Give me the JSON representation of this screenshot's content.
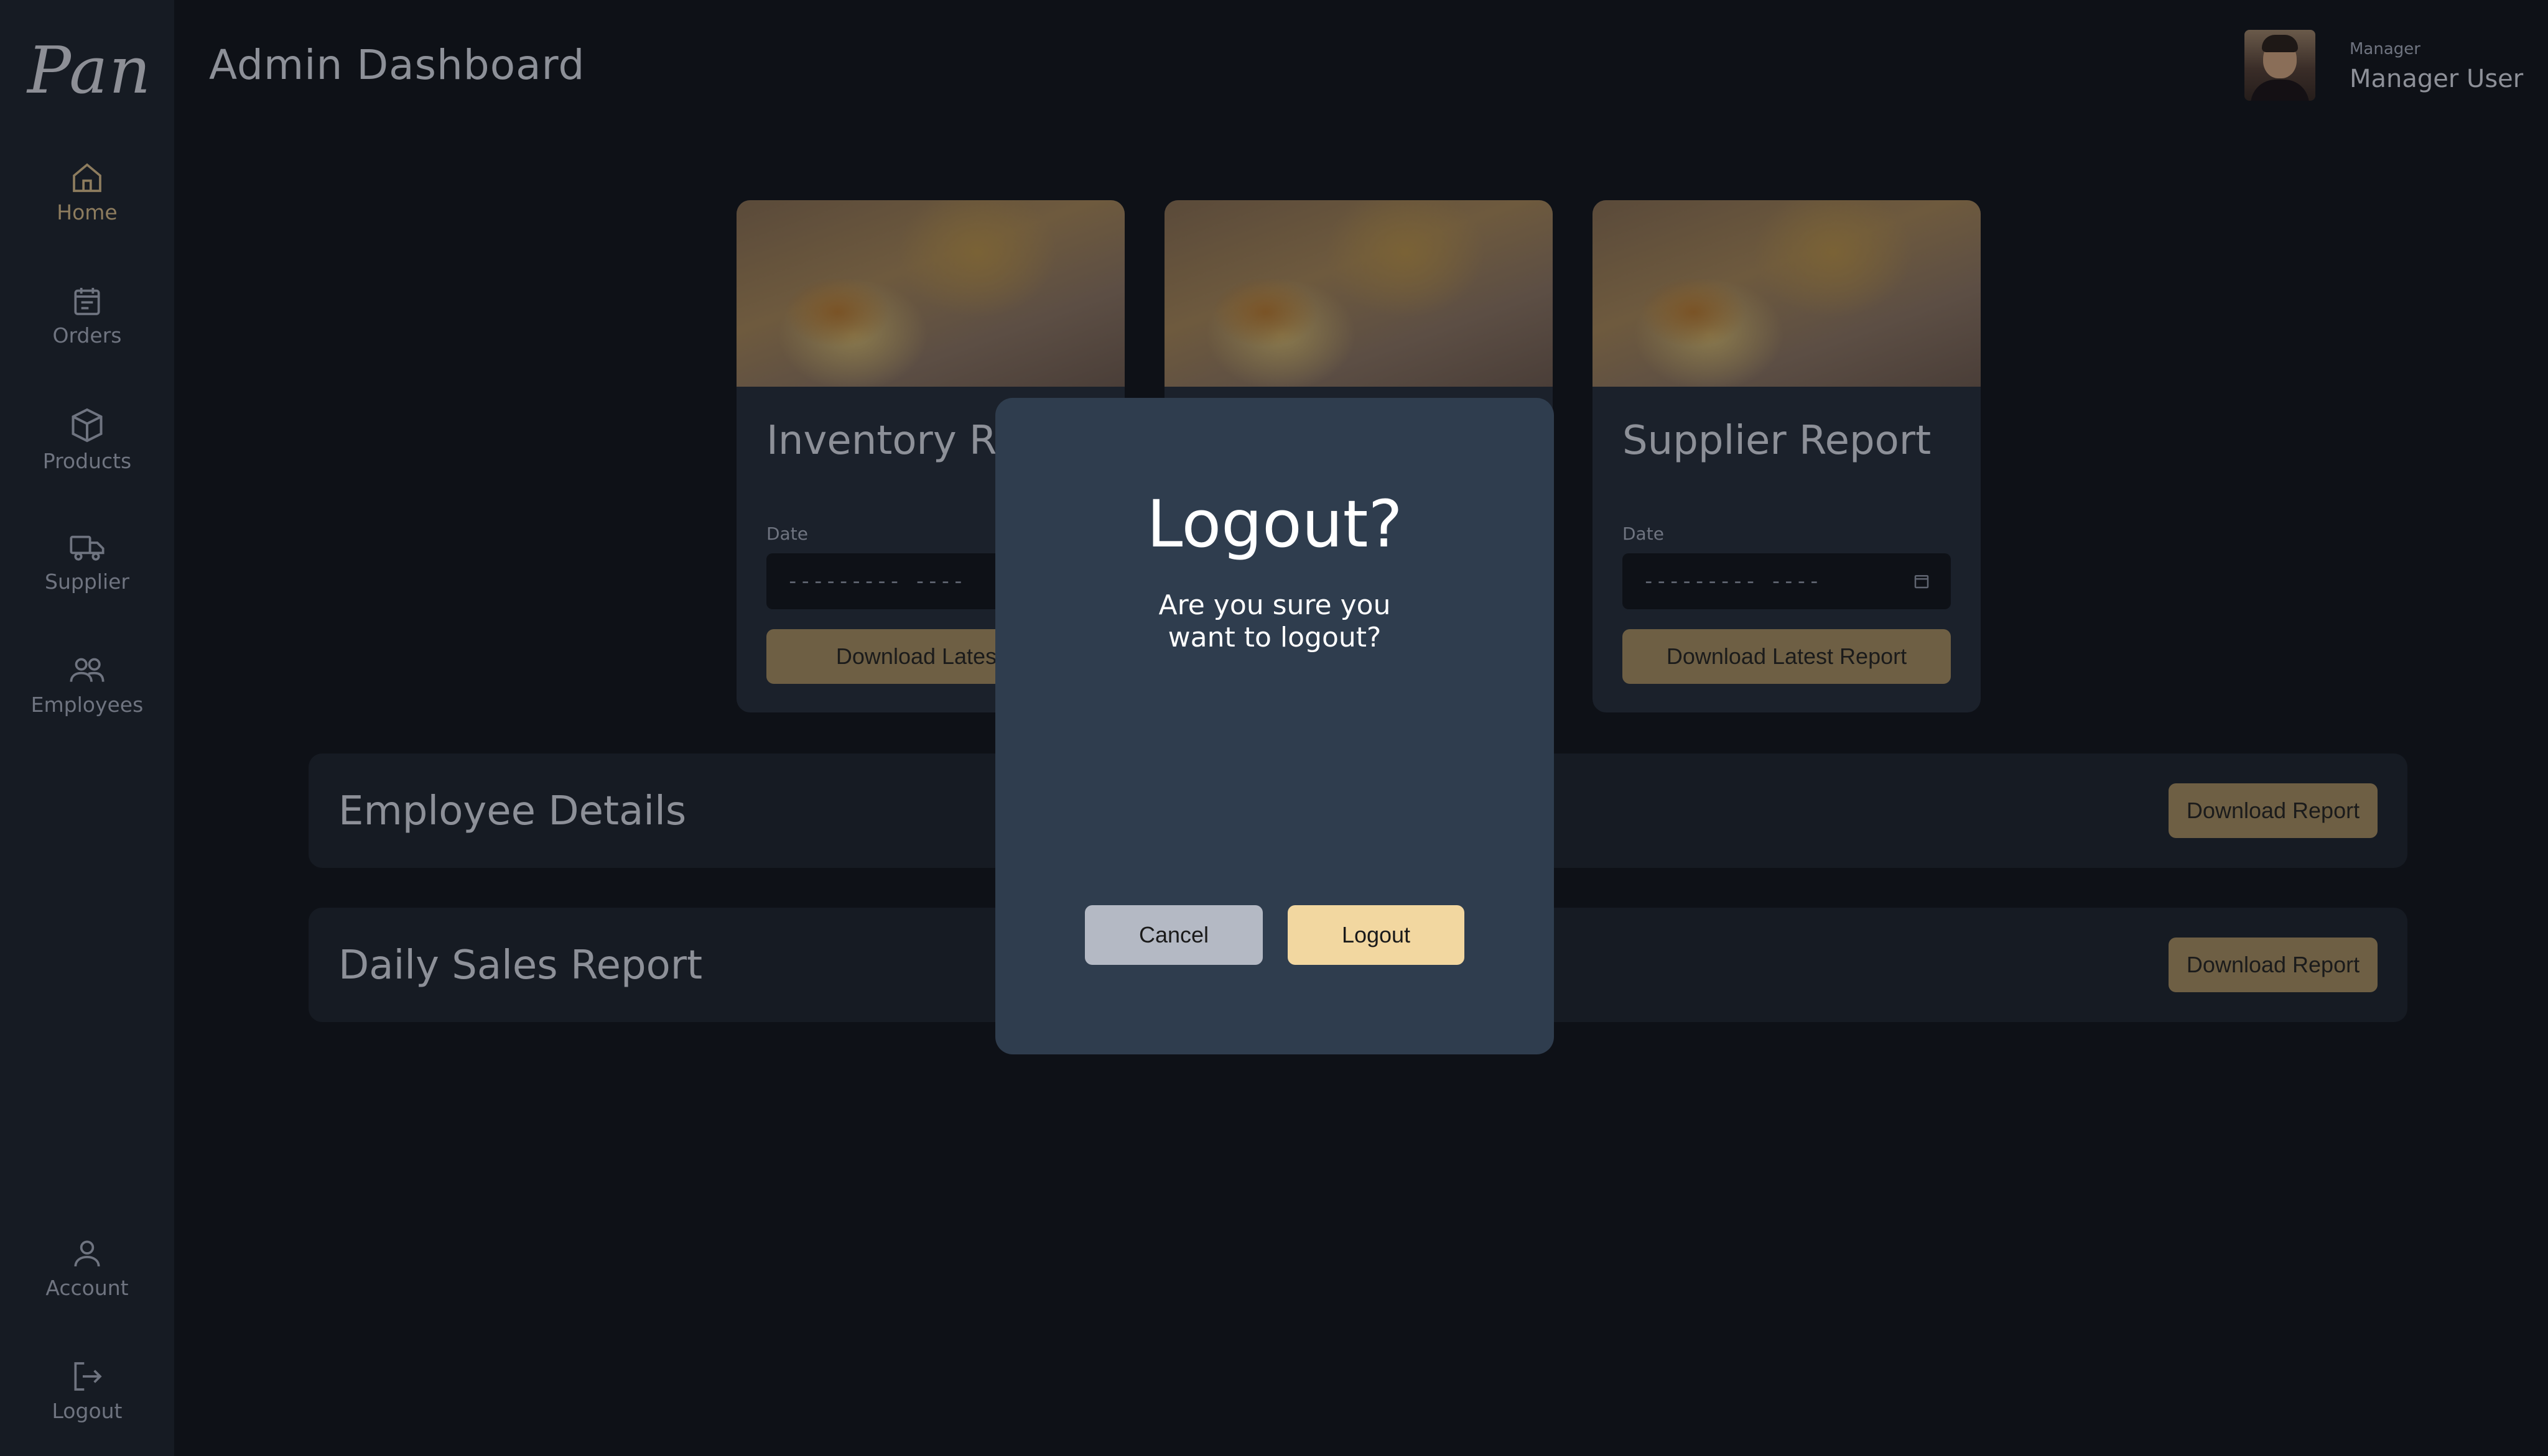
{
  "sidebar": {
    "logo": "Pan",
    "items": [
      {
        "label": "Home",
        "icon": "home-icon"
      },
      {
        "label": "Orders",
        "icon": "calendar-icon"
      },
      {
        "label": "Products",
        "icon": "box-icon"
      },
      {
        "label": "Supplier",
        "icon": "truck-icon"
      },
      {
        "label": "Employees",
        "icon": "users-icon"
      }
    ],
    "bottom_items": [
      {
        "label": "Account",
        "icon": "user-icon"
      },
      {
        "label": "Logout",
        "icon": "logout-icon"
      }
    ]
  },
  "header": {
    "title": "Admin Dashboard",
    "user_role": "Manager",
    "user_name": "Manager User"
  },
  "report_cards": [
    {
      "title": "Inventory Re",
      "date_label": "Date",
      "date_placeholder": "--------- ----",
      "button_label": "Download Latest R"
    },
    {
      "title": "",
      "date_label": "",
      "date_placeholder": "",
      "button_label": ""
    },
    {
      "title": "Supplier Report",
      "date_label": "Date",
      "date_placeholder": "--------- ----",
      "button_label": "Download Latest Report"
    }
  ],
  "rows": [
    {
      "title": "Employee Details",
      "button_label": "Download Report"
    },
    {
      "title": "Daily Sales Report",
      "button_label": "Download Report"
    }
  ],
  "modal": {
    "title": "Logout?",
    "message": "Are you sure you want to logout?",
    "cancel_label": "Cancel",
    "confirm_label": "Logout"
  },
  "colors": {
    "accent": "#f2d7a0",
    "modal_bg": "#2f3d4e",
    "background": "#0e1117"
  }
}
